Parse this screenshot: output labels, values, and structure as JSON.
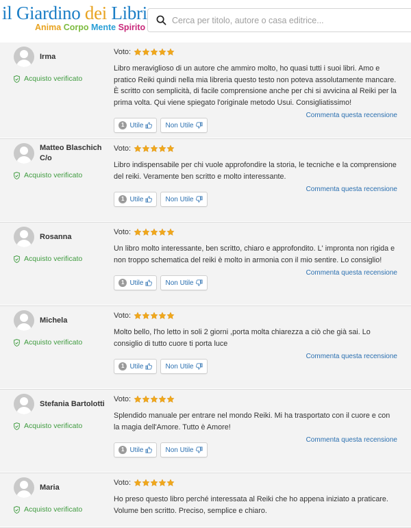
{
  "logo": {
    "il": "il",
    "giardino": "Giardino",
    "dei": "dei",
    "libri": "Libri",
    "tagline": [
      "Anima",
      "Corpo",
      "Mente",
      "Spirito"
    ]
  },
  "search": {
    "placeholder": "Cerca per titolo, autore o casa editrice..."
  },
  "labels": {
    "verified": "Acquisto verificato",
    "voto": "Voto:",
    "utile": "Utile",
    "non_utile": "Non Utile",
    "commenta": "Commenta questa recensione"
  },
  "colors": {
    "star": "#f0a81c",
    "link": "#2a6fb0",
    "verified": "#3f9b3f",
    "card_bg": "#f3f3f3"
  },
  "reviews": [
    {
      "user": "Irma",
      "stars": 5,
      "utile_count": "1",
      "text": "Libro meraviglioso di un autore che ammiro molto, ho quasi tutti i suoi libri. Amo e pratico Reiki quindi nella mia libreria questo testo non poteva assolutamente mancare. È scritto con semplicità, di facile comprensione anche per chi si avvicina al Reiki per la prima volta. Qui viene spiegato l'originale metodo Usui. Consigliatissimo!"
    },
    {
      "user": "Matteo Blaschich C/o",
      "stars": 5,
      "utile_count": "1",
      "text": "Libro indispensabile per chi vuole approfondire la storia, le tecniche e la comprensione del reiki. Veramente ben scritto e molto interessante."
    },
    {
      "user": "Rosanna",
      "stars": 5,
      "utile_count": "1",
      "text": "Un libro molto interessante, ben scritto, chiaro e approfondito. L' impronta non rigida e non troppo schematica del reiki è molto in armonia con il mio sentire. Lo consiglio!"
    },
    {
      "user": "Michela",
      "stars": 5,
      "utile_count": "1",
      "text": "Molto bello, l'ho letto in soli 2 giorni ,porta molta chiarezza a ciò che già sai. Lo consiglio di tutto cuore ti porta luce"
    },
    {
      "user": "Stefania Bartolotti",
      "stars": 5,
      "utile_count": "1",
      "text": "Splendido manuale per entrare nel mondo Reiki. Mi ha trasportato con il cuore e con la magia dell'Amore. Tutto è Amore!"
    },
    {
      "user": "Maria",
      "stars": 5,
      "utile_count": "",
      "text": "Ho preso questo libro perché interessata al Reiki che ho appena iniziato a praticare. Volume ben scritto. Preciso, semplice e chiaro."
    }
  ]
}
